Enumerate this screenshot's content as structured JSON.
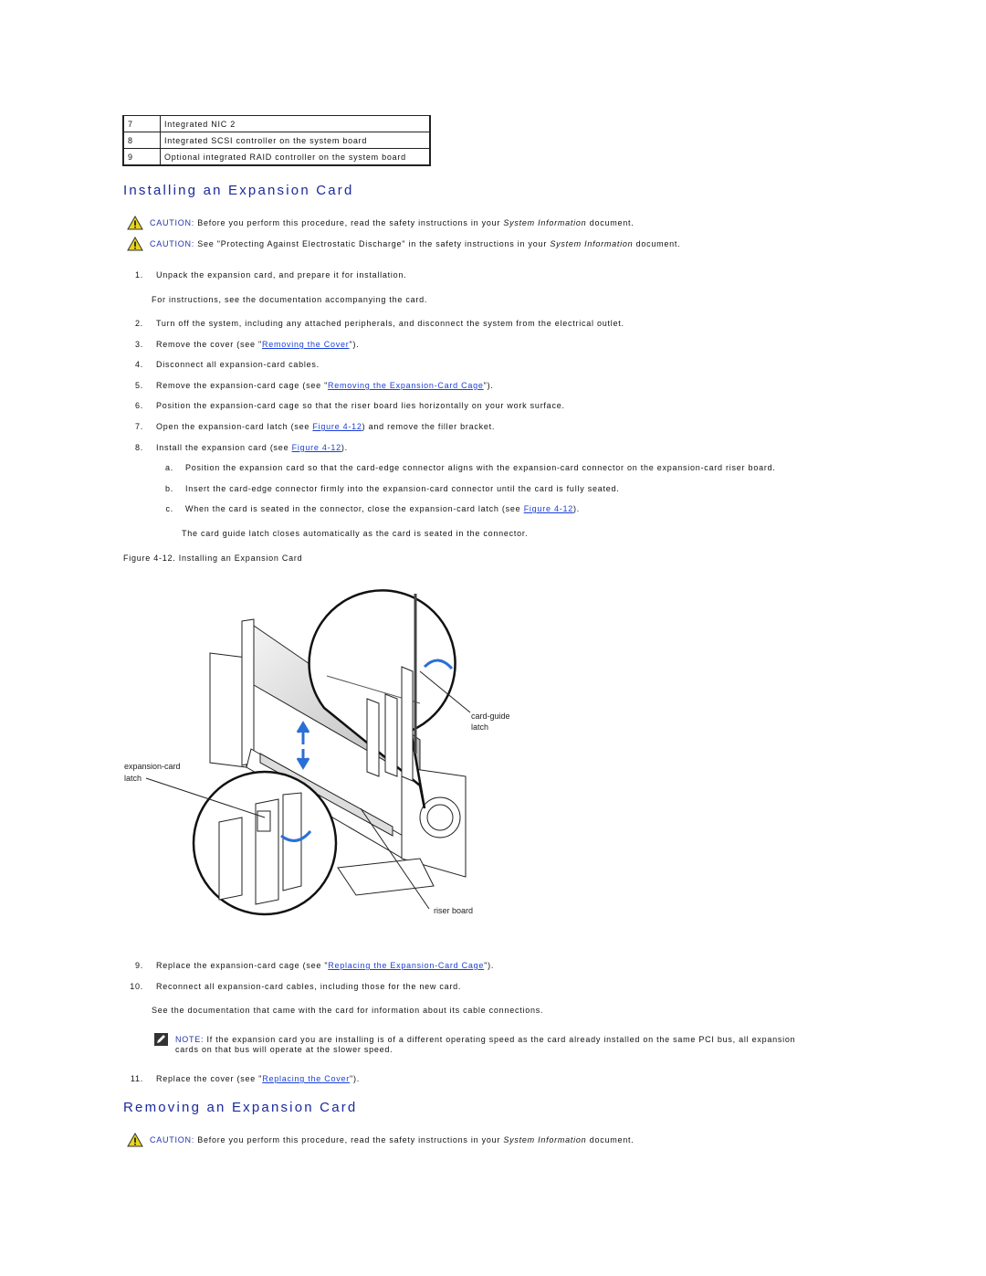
{
  "table": {
    "rows": [
      [
        "7",
        "Integrated NIC 2"
      ],
      [
        "8",
        "Integrated SCSI controller on the system board"
      ],
      [
        "9",
        "Optional integrated RAID controller on the system board"
      ]
    ]
  },
  "section1": {
    "title": "Installing an Expansion Card",
    "cautions": [
      {
        "label": "CAUTION:",
        "pre": " Before you perform this procedure, read the safety instructions in your ",
        "em": "System Information",
        "post": " document."
      },
      {
        "label": "CAUTION:",
        "pre": " See \"Protecting Against Electrostatic Discharge\" in the safety instructions in your ",
        "em": "System Information",
        "post": " document."
      }
    ],
    "steps": [
      {
        "num": "1.",
        "text": "Unpack the expansion card, and prepare it for installation."
      },
      {
        "sub": "For instructions, see the documentation accompanying the card."
      },
      {
        "num": "2.",
        "text": "Turn off the system, including any attached peripherals, and disconnect the system from the electrical outlet."
      },
      {
        "num": "3.",
        "pre": "Remove the cover (see \"",
        "link": "Removing the Cover",
        "post": "\")."
      },
      {
        "num": "4.",
        "text": "Disconnect all expansion-card cables."
      },
      {
        "num": "5.",
        "pre": "Remove the expansion-card cage (see \"",
        "link": "Removing the Expansion-Card Cage",
        "post": "\")."
      },
      {
        "num": "6.",
        "text": "Position the expansion-card cage so that the riser board lies horizontally on your work surface."
      },
      {
        "num": "7.",
        "pre": "Open the expansion-card latch (see ",
        "link": "Figure 4-12",
        "post": ") and remove the filler bracket."
      },
      {
        "num": "8.",
        "pre": "Install the expansion card (see ",
        "link": "Figure 4-12",
        "post": ")."
      }
    ],
    "substeps": [
      {
        "num": "a.",
        "text": "Position the expansion card so that the card-edge connector aligns with the expansion-card connector on the expansion-card riser board."
      },
      {
        "num": "b.",
        "text": "Insert the card-edge connector firmly into the expansion-card connector until the card is fully seated."
      },
      {
        "num": "c.",
        "pre": "When the card is seated in the connector, close the expansion-card latch (see ",
        "link": "Figure 4-12",
        "post": ")."
      }
    ],
    "substep_note": "The card guide latch closes automatically as the card is seated in the connector.",
    "figure": {
      "caption": "Figure 4-12. Installing an Expansion Card",
      "labels": {
        "card_guide_1": "card-guide",
        "card_guide_2": "latch",
        "exp_latch_1": "expansion-card",
        "exp_latch_2": "latch",
        "riser": "riser board"
      },
      "arrow_color": "#2a6fd6"
    },
    "steps2": [
      {
        "num": "9.",
        "pre": "Replace the expansion-card cage (see \"",
        "link": "Replacing the Expansion-Card Cage",
        "post": "\")."
      },
      {
        "num": "10.",
        "text": "Reconnect all expansion-card cables, including those for the new card."
      },
      {
        "sub": "See the documentation that came with the card for information about its cable connections."
      }
    ],
    "note": {
      "label": "NOTE:",
      "line1": " If the expansion card you are installing is of a different operating speed as the card already installed on the same PCI bus, all expansion",
      "line2": "cards on that bus will operate at the slower speed."
    },
    "step11": {
      "num": "11.",
      "pre": "Replace the cover (see \"",
      "link": "Replacing the Cover",
      "post": "\")."
    }
  },
  "section2": {
    "title": "Removing an Expansion Card",
    "caution": {
      "label": "CAUTION:",
      "pre": " Before you perform this procedure, read the safety instructions in your ",
      "em": "System Information",
      "post": " document."
    }
  },
  "colors": {
    "heading": "#1a2a9c",
    "link": "#1a3fd6",
    "caution_icon": "#e8d51a"
  }
}
